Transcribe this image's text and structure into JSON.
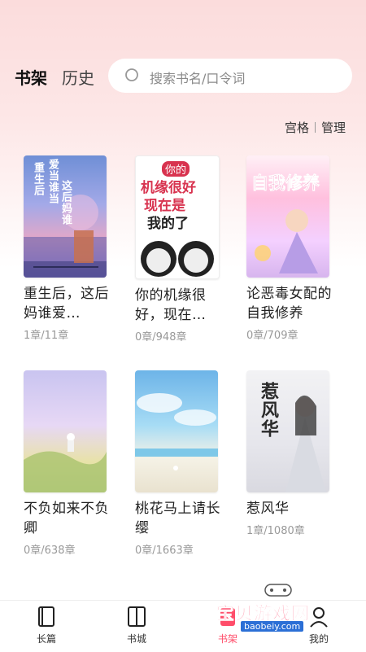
{
  "header": {
    "tab_shelf": "书架",
    "tab_history": "历史",
    "search_placeholder": "搜索书名/口令词"
  },
  "manage": {
    "grid": "宫格",
    "manage": "管理"
  },
  "books": [
    {
      "title": "重生后，这后妈谁爱…",
      "progress": "1章/11章",
      "cover_text": [
        "重生后",
        "爱当谁当",
        "这后妈谁"
      ]
    },
    {
      "title": "你的机缘很好，现在…",
      "progress": "0章/948章",
      "cover_text": [
        "你的",
        "机缘很好",
        "现在是",
        "我的了"
      ]
    },
    {
      "title": "论恶毒女配的自我修养",
      "progress": "0章/709章",
      "cover_text": [
        "自我修养"
      ]
    },
    {
      "title": "不负如来不负卿",
      "progress": "0章/638章",
      "cover_text": []
    },
    {
      "title": "桃花马上请长缨",
      "progress": "0章/1663章",
      "cover_text": []
    },
    {
      "title": "惹风华",
      "progress": "1章/1080章",
      "cover_text": [
        "惹风华"
      ]
    }
  ],
  "tabbar": [
    {
      "label": "长篇",
      "icon": "book-icon"
    },
    {
      "label": "书城",
      "icon": "library-icon"
    },
    {
      "label": "书架",
      "icon": "bookshelf-icon"
    },
    {
      "label": "我的",
      "icon": "profile-icon"
    }
  ],
  "watermark": {
    "text": "宝贝游戏网",
    "url": "baobeiy.com"
  },
  "colors": {
    "accent": "#ff4d6a",
    "bg_top": "#fbdcdc"
  }
}
